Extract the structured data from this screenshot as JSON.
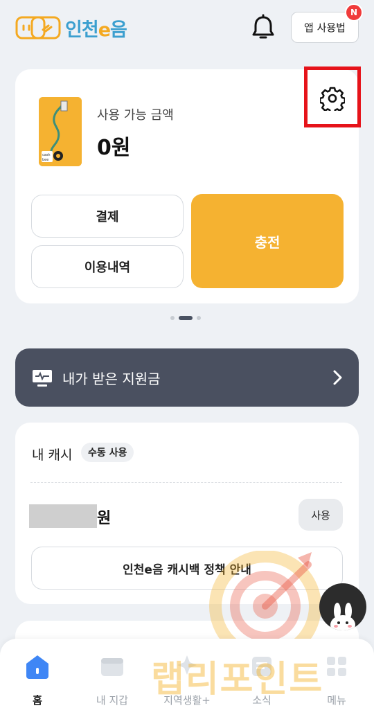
{
  "header": {
    "logo_text": "인천e음",
    "guide_button": "앱 사용법",
    "notification_badge": "N"
  },
  "balance": {
    "label": "사용 가능 금액",
    "amount": "0원",
    "card_image_text": "cash bee",
    "pay_button": "결제",
    "history_button": "이용내역",
    "charge_button": "충전"
  },
  "pager": {
    "count": 3,
    "active": 1
  },
  "subsidy": {
    "label": "내가 받은 지원금"
  },
  "cash": {
    "title": "내 캐시",
    "badge": "수동 사용",
    "unit": "원",
    "use_button": "사용",
    "policy_button": "인천e음 캐시백 정책 안내"
  },
  "bottom_nav": {
    "items": [
      {
        "label": "홈",
        "icon": "home-icon",
        "active": true
      },
      {
        "label": "내 지갑",
        "icon": "wallet-icon",
        "active": false
      },
      {
        "label": "지역생활+",
        "icon": "local-life-icon",
        "active": false
      },
      {
        "label": "소식",
        "icon": "news-icon",
        "active": false
      },
      {
        "label": "메뉴",
        "icon": "menu-icon",
        "active": false
      }
    ]
  },
  "watermark": {
    "text": "랩리포인트"
  },
  "colors": {
    "accent": "#f5b231",
    "banner": "#4a5060",
    "highlight_box": "#e6131a",
    "logo_blue": "#3b9fcf"
  }
}
